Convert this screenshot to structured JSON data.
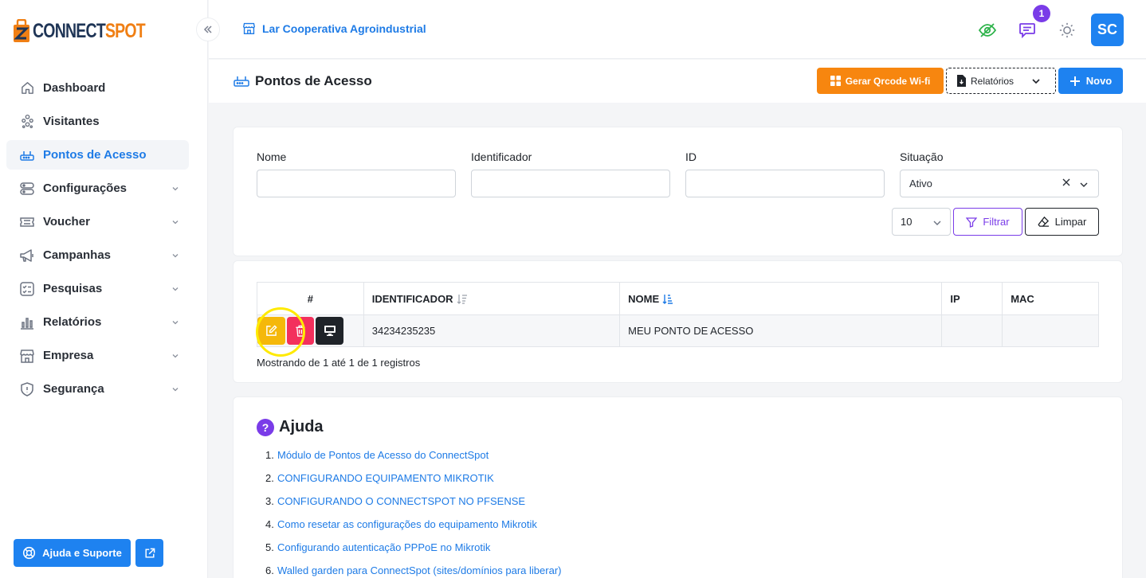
{
  "brand": {
    "logo_part1": "CONNECT",
    "logo_part2": "SPOT"
  },
  "colors": {
    "primary": "#1e82f0",
    "accent_orange": "#f7860f",
    "purple": "#7a3ce8",
    "edit": "#f5b80a",
    "delete": "#f3305d",
    "dark": "#1f2329"
  },
  "sidebar": {
    "items": [
      {
        "label": "Dashboard",
        "icon": "home-icon",
        "active": false,
        "has_submenu": false
      },
      {
        "label": "Visitantes",
        "icon": "users-icon",
        "active": false,
        "has_submenu": false
      },
      {
        "label": "Pontos de Acesso",
        "icon": "router-icon",
        "active": true,
        "has_submenu": false
      },
      {
        "label": "Configurações",
        "icon": "server-icon",
        "active": false,
        "has_submenu": true
      },
      {
        "label": "Voucher",
        "icon": "ticket-icon",
        "active": false,
        "has_submenu": true
      },
      {
        "label": "Campanhas",
        "icon": "megaphone-icon",
        "active": false,
        "has_submenu": true
      },
      {
        "label": "Pesquisas",
        "icon": "checklist-icon",
        "active": false,
        "has_submenu": true
      },
      {
        "label": "Relatórios",
        "icon": "bar-chart-icon",
        "active": false,
        "has_submenu": true
      },
      {
        "label": "Empresa",
        "icon": "store-icon",
        "active": false,
        "has_submenu": true
      },
      {
        "label": "Segurança",
        "icon": "shield-icon",
        "active": false,
        "has_submenu": true
      }
    ],
    "support_label": "Ajuda e Suporte"
  },
  "topbar": {
    "company": "Lar Cooperativa Agroindustrial",
    "notification_count": "1",
    "avatar_initials": "SC"
  },
  "page": {
    "title": "Pontos de Acesso",
    "qrcode_button": "Gerar Qrcode Wi-fi",
    "reports_button": "Relatórios",
    "new_button": "Novo"
  },
  "filters": {
    "name_label": "Nome",
    "identifier_label": "Identificador",
    "id_label": "ID",
    "status_label": "Situação",
    "status_value": "Ativo",
    "per_page": "10",
    "filter_button": "Filtrar",
    "clear_button": "Limpar"
  },
  "table": {
    "headers": [
      "#",
      "IDENTIFICADOR",
      "NOME",
      "IP",
      "MAC"
    ],
    "rows": [
      {
        "identificador": "34234235235",
        "nome": "MEU PONTO DE ACESSO",
        "ip": "",
        "mac": ""
      }
    ],
    "records_text": "Mostrando de 1 até 1 de 1 registros"
  },
  "help": {
    "title": "Ajuda",
    "items": [
      "Módulo de Pontos de Acesso do ConnectSpot",
      "CONFIGURANDO EQUIPAMENTO MIKROTIK",
      "CONFIGURANDO O CONNECTSPOT NO PFSENSE",
      "Como resetar as configurações do equipamento Mikrotik",
      "Configurando autenticação PPPoE no Mikrotik",
      "Walled garden para ConnectSpot (sites/domínios para liberar)"
    ]
  }
}
